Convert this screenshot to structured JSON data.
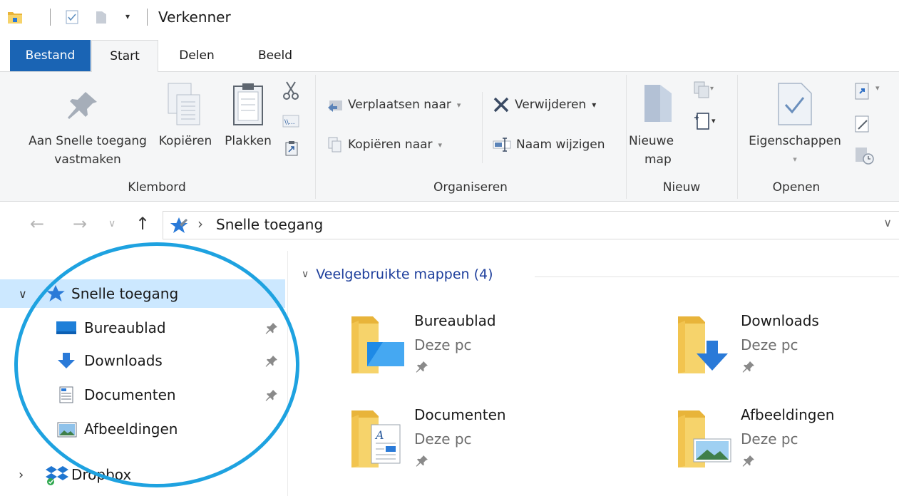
{
  "window": {
    "title": "Verkenner"
  },
  "ribbon": {
    "tabs": [
      {
        "label": "Bestand"
      },
      {
        "label": "Start"
      },
      {
        "label": "Delen"
      },
      {
        "label": "Beeld"
      }
    ],
    "groups": {
      "klembord": {
        "label": "Klembord",
        "pin_label_1": "Aan Snelle toegang",
        "pin_label_2": "vastmaken",
        "copy_label": "Kopiëren",
        "paste_label": "Plakken"
      },
      "organiseren": {
        "label": "Organiseren",
        "move_to": "Verplaatsen naar",
        "copy_to": "Kopiëren naar",
        "delete": "Verwijderen",
        "rename": "Naam wijzigen"
      },
      "nieuw": {
        "label": "Nieuw",
        "new_folder_1": "Nieuwe",
        "new_folder_2": "map"
      },
      "openen": {
        "label": "Openen",
        "properties": "Eigenschappen"
      }
    }
  },
  "address": {
    "location": "Snelle toegang"
  },
  "nav": {
    "items": [
      {
        "label": "Snelle toegang"
      },
      {
        "label": "Bureaublad"
      },
      {
        "label": "Downloads"
      },
      {
        "label": "Documenten"
      },
      {
        "label": "Afbeeldingen"
      },
      {
        "label": "Dropbox"
      }
    ]
  },
  "content": {
    "section_title": "Veelgebruikte mappen (4)",
    "folders": [
      {
        "name": "Bureaublad",
        "location": "Deze pc"
      },
      {
        "name": "Downloads",
        "location": "Deze pc"
      },
      {
        "name": "Documenten",
        "location": "Deze pc"
      },
      {
        "name": "Afbeeldingen",
        "location": "Deze pc"
      }
    ]
  },
  "colors": {
    "file_tab": "#1a64b4",
    "selection": "#cce8ff",
    "section_heading": "#1e3f9c",
    "annotation_circle": "#1ea2e0",
    "folder_yellow": "#f6d36b"
  }
}
